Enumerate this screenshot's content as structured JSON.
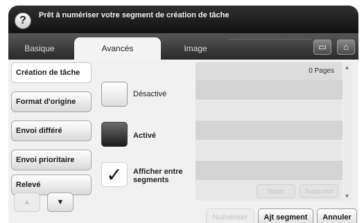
{
  "header": {
    "help_icon": "question-icon",
    "help_glyph": "?",
    "title": "Prêt à numériser votre segment de création de tâche"
  },
  "tabs": [
    {
      "label": "Basique",
      "active": false
    },
    {
      "label": "Avancés",
      "active": true
    },
    {
      "label": "Image",
      "active": false
    }
  ],
  "toolbar": {
    "icons": [
      "tray-icon",
      "home-icon"
    ],
    "glyphs": [
      "▭",
      "⌂"
    ]
  },
  "sidebar": {
    "items": [
      {
        "label": "Création de tâche",
        "active": true
      },
      {
        "label": "Format d'origine",
        "active": false
      },
      {
        "label": "Envoi différé",
        "active": false
      },
      {
        "label": "Envoi prioritaire",
        "active": false
      },
      {
        "label": "Relevé",
        "active": false
      }
    ],
    "prev_glyph": "▲",
    "next_glyph": "▼"
  },
  "options": [
    {
      "label": "Désactivé",
      "state": "off"
    },
    {
      "label": "Activé",
      "state": "on"
    },
    {
      "label": "Afficher entre segments",
      "state": "checked",
      "check_glyph": "✓"
    }
  ],
  "pages_panel": {
    "count_label": "0 Pages",
    "row_count": 6,
    "ghost_buttons": [
      "Suppr.",
      "Suppr.tout"
    ],
    "scroll_up": "▲",
    "scroll_down": "▼"
  },
  "footer": {
    "disabled_label": "Numériser",
    "add_segment": "Ajt segment",
    "cancel": "Annuler"
  },
  "colors": {
    "header_bg": "#1e1e1e",
    "tabbar_bg": "#3a3a3a",
    "content_bg": "#f1f1f1",
    "row_dark": "#d4d4d4",
    "row_light": "#e7e7e7"
  }
}
